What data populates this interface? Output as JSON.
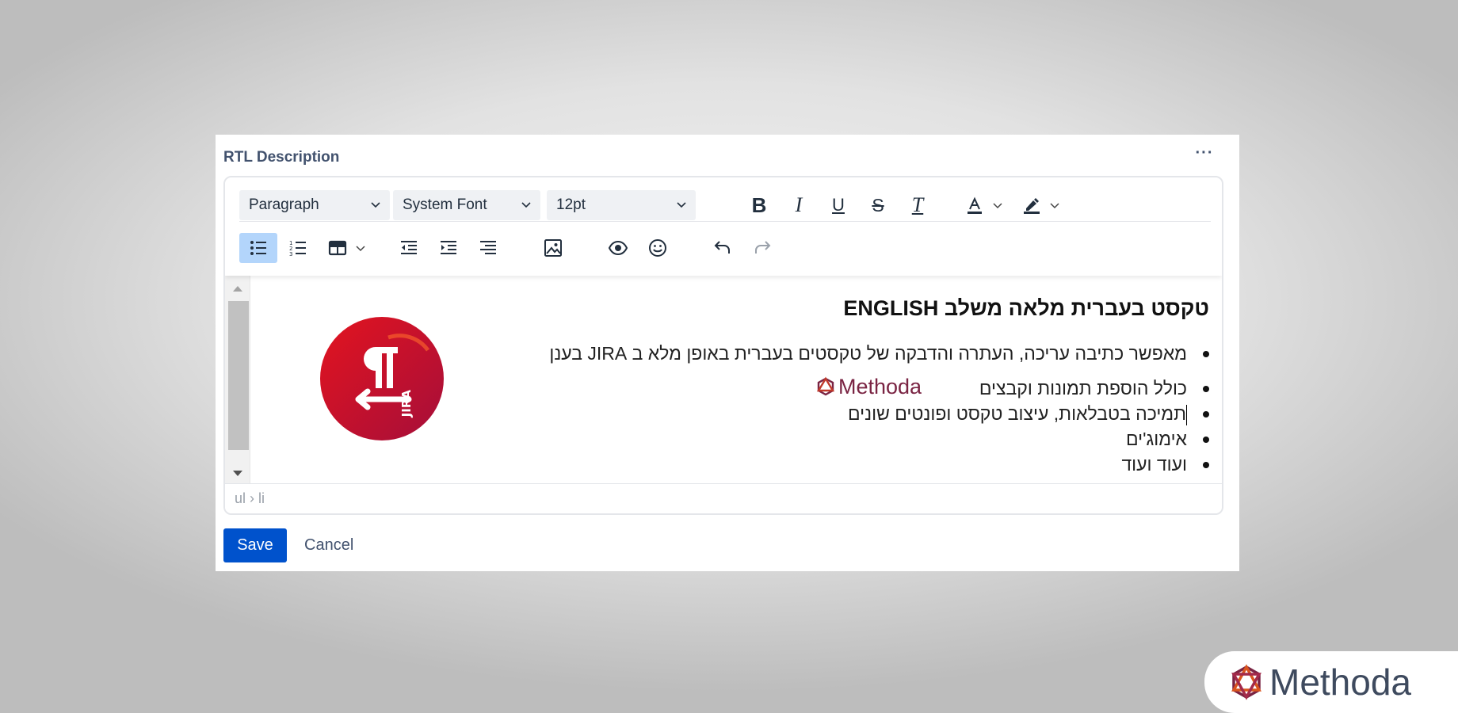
{
  "panel": {
    "title": "RTL Description",
    "more_label": "···"
  },
  "toolbar": {
    "block_format": "Paragraph",
    "font_family": "System Font",
    "font_size": "12pt",
    "bold_label": "B",
    "italic_label": "I",
    "underline_label": "U",
    "strike_label": "S",
    "clear_label": "T"
  },
  "content": {
    "heading": "טקסט בעברית מלאה משלב ENGLISH",
    "bullets": [
      "מאפשר כתיבה עריכה, העתרה והדבקה של טקסטים בעברית באופן מלא ב JIRA בענן",
      "כולל הוספת תמונות וקבצים",
      "תמיכה בטבלאות, עיצוב טקסט ופונטים שונים",
      "אימוג'ים",
      "ועוד ועוד"
    ],
    "inline_logo_text": "Methoda",
    "jira_logo_text": "JIRA"
  },
  "statusbar": {
    "path": "ul › li"
  },
  "actions": {
    "save_label": "Save",
    "cancel_label": "Cancel"
  },
  "brand": {
    "name": "Methoda"
  },
  "colors": {
    "accent": "#0052cc",
    "active_button": "#b3d5fb",
    "jira_red": "#c8102e",
    "brand_text": "#3e4a5e"
  }
}
